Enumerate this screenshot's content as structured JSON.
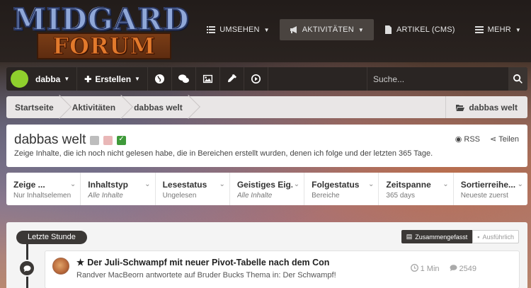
{
  "logo": {
    "line1": "MIDGARD",
    "line2": "FORUM"
  },
  "nav": [
    {
      "label": "UMSEHEN",
      "icon": "list-icon",
      "caret": true
    },
    {
      "label": "AKTIVITÄTEN",
      "icon": "megaphone-icon",
      "caret": true,
      "active": true
    },
    {
      "label": "ARTIKEL (CMS)",
      "icon": "document-icon",
      "caret": false
    },
    {
      "label": "MEHR",
      "icon": "menu-icon",
      "caret": true
    }
  ],
  "toolbar": {
    "username": "dabba",
    "create_label": "Erstellen",
    "search_placeholder": "Suche..."
  },
  "breadcrumb": {
    "items": [
      "Startseite",
      "Aktivitäten",
      "dabbas welt"
    ],
    "right": "dabbas welt"
  },
  "page": {
    "title": "dabbas welt",
    "description": "Zeige Inhalte, die ich noch nicht gelesen habe, die in Bereichen erstellt wurden, denen ich folge und der letzten 365 Tage.",
    "rss": "RSS",
    "share": "Teilen"
  },
  "filters": [
    {
      "label": "Zeige ...",
      "value": "Nur Inhaltselemen...",
      "italic": false
    },
    {
      "label": "Inhaltstyp",
      "value": "Alle Inhalte",
      "italic": true
    },
    {
      "label": "Lesestatus",
      "value": "Ungelesen",
      "italic": false
    },
    {
      "label": "Geistiges Eig...",
      "value": "Alle Inhalte",
      "italic": true
    },
    {
      "label": "Folgestatus",
      "value": "Bereiche",
      "italic": false
    },
    {
      "label": "Zeitspanne",
      "value": "365 days",
      "italic": false
    },
    {
      "label": "Sortierreihe...",
      "value": "Neueste zuerst",
      "italic": false
    }
  ],
  "stream": {
    "section_label": "Letzte Stunde",
    "view_condensed": "Zusammengefasst",
    "view_expanded": "Ausführlich",
    "item": {
      "title": "Der Juli-Schwampf mit neuer Pivot-Tabelle nach dem Con",
      "subtitle": "Randver MacBeorn antwortete auf Bruder Bucks Thema in: Der Schwampf!",
      "time": "1 Min",
      "replies": "2549"
    }
  }
}
